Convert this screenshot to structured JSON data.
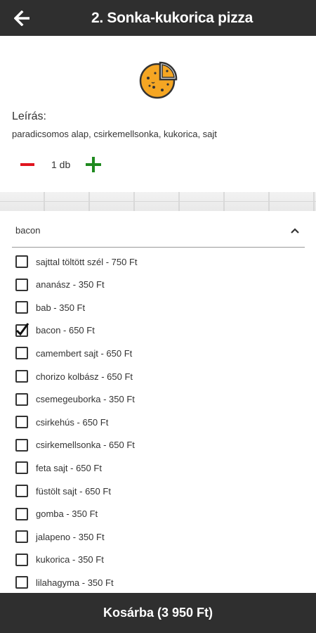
{
  "header": {
    "title": "2. Sonka-kukorica pizza",
    "back_icon": "arrow-left-icon"
  },
  "product": {
    "icon": "pizza-icon",
    "description_label": "Leírás:",
    "description": "paradicsomos alap, csirkemellsonka, kukorica, sajt",
    "quantity": "1 db",
    "minus_icon": "minus-icon",
    "plus_icon": "plus-icon"
  },
  "extras": {
    "selected_value": "bacon",
    "chevron_icon": "chevron-up-icon",
    "options": [
      {
        "label": "sajttal töltött szél - 750 Ft",
        "checked": false
      },
      {
        "label": "ananász - 350 Ft",
        "checked": false
      },
      {
        "label": "bab - 350 Ft",
        "checked": false
      },
      {
        "label": "bacon - 650 Ft",
        "checked": true
      },
      {
        "label": "camembert sajt - 650 Ft",
        "checked": false
      },
      {
        "label": "chorizo kolbász - 650 Ft",
        "checked": false
      },
      {
        "label": "csemegeuborka - 350 Ft",
        "checked": false
      },
      {
        "label": "csirkehús - 650 Ft",
        "checked": false
      },
      {
        "label": "csirkemellsonka - 650 Ft",
        "checked": false
      },
      {
        "label": "feta sajt - 650 Ft",
        "checked": false
      },
      {
        "label": "füstölt sajt - 650 Ft",
        "checked": false
      },
      {
        "label": "gomba - 350 Ft",
        "checked": false
      },
      {
        "label": "jalapeno - 350 Ft",
        "checked": false
      },
      {
        "label": "kukorica - 350 Ft",
        "checked": false
      },
      {
        "label": "lilahagyma - 350 Ft",
        "checked": false
      }
    ]
  },
  "cart": {
    "label": "Kosárba (3 950 Ft)"
  },
  "colors": {
    "bar": "#2f2f2f",
    "minus": "#e0141e",
    "plus": "#1f8a1f",
    "pizza_fill": "#f5a623"
  }
}
